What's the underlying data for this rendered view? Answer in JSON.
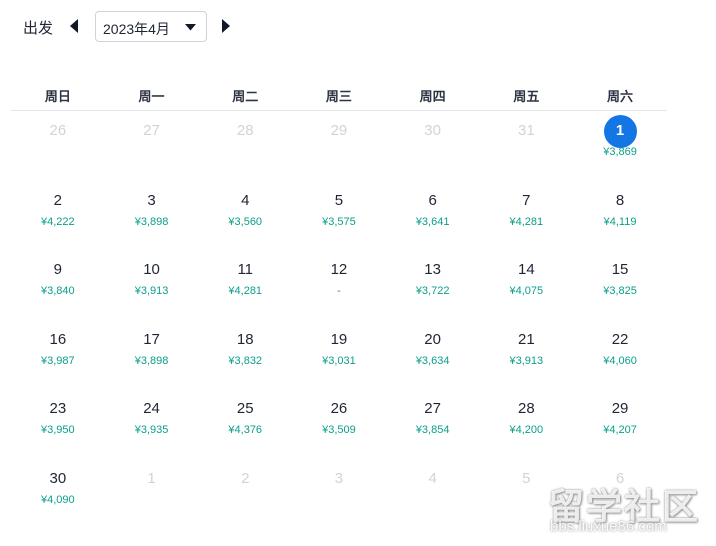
{
  "toolbar": {
    "depart_label": "出发",
    "month_value": "2023年4月",
    "prev_icon": "caret-left-icon",
    "next_icon": "caret-right-icon",
    "dropdown_icon": "caret-down-icon"
  },
  "weekdays": [
    "周日",
    "周一",
    "周二",
    "周三",
    "周四",
    "周五",
    "周六"
  ],
  "colors": {
    "price": "#0b9e8a",
    "selected": "#1476e4",
    "disabled_text": "#d0d3d9"
  },
  "calendar": {
    "weeks": [
      [
        {
          "day": "26",
          "price": "",
          "state": "disabled"
        },
        {
          "day": "27",
          "price": "",
          "state": "disabled"
        },
        {
          "day": "28",
          "price": "",
          "state": "disabled"
        },
        {
          "day": "29",
          "price": "",
          "state": "disabled"
        },
        {
          "day": "30",
          "price": "",
          "state": "disabled"
        },
        {
          "day": "31",
          "price": "",
          "state": "disabled"
        },
        {
          "day": "1",
          "price": "¥3,869",
          "state": "selected"
        }
      ],
      [
        {
          "day": "2",
          "price": "¥4,222",
          "state": "normal"
        },
        {
          "day": "3",
          "price": "¥3,898",
          "state": "normal"
        },
        {
          "day": "4",
          "price": "¥3,560",
          "state": "normal"
        },
        {
          "day": "5",
          "price": "¥3,575",
          "state": "normal"
        },
        {
          "day": "6",
          "price": "¥3,641",
          "state": "normal"
        },
        {
          "day": "7",
          "price": "¥4,281",
          "state": "normal"
        },
        {
          "day": "8",
          "price": "¥4,119",
          "state": "normal"
        }
      ],
      [
        {
          "day": "9",
          "price": "¥3,840",
          "state": "normal"
        },
        {
          "day": "10",
          "price": "¥3,913",
          "state": "normal"
        },
        {
          "day": "11",
          "price": "¥4,281",
          "state": "normal"
        },
        {
          "day": "12",
          "price": "-",
          "state": "normal"
        },
        {
          "day": "13",
          "price": "¥3,722",
          "state": "normal"
        },
        {
          "day": "14",
          "price": "¥4,075",
          "state": "normal"
        },
        {
          "day": "15",
          "price": "¥3,825",
          "state": "normal"
        }
      ],
      [
        {
          "day": "16",
          "price": "¥3,987",
          "state": "normal"
        },
        {
          "day": "17",
          "price": "¥3,898",
          "state": "normal"
        },
        {
          "day": "18",
          "price": "¥3,832",
          "state": "normal"
        },
        {
          "day": "19",
          "price": "¥3,031",
          "state": "normal"
        },
        {
          "day": "20",
          "price": "¥3,634",
          "state": "normal"
        },
        {
          "day": "21",
          "price": "¥3,913",
          "state": "normal"
        },
        {
          "day": "22",
          "price": "¥4,060",
          "state": "normal"
        }
      ],
      [
        {
          "day": "23",
          "price": "¥3,950",
          "state": "normal"
        },
        {
          "day": "24",
          "price": "¥3,935",
          "state": "normal"
        },
        {
          "day": "25",
          "price": "¥4,376",
          "state": "normal"
        },
        {
          "day": "26",
          "price": "¥3,509",
          "state": "normal"
        },
        {
          "day": "27",
          "price": "¥3,854",
          "state": "normal"
        },
        {
          "day": "28",
          "price": "¥4,200",
          "state": "normal"
        },
        {
          "day": "29",
          "price": "¥4,207",
          "state": "normal"
        }
      ],
      [
        {
          "day": "30",
          "price": "¥4,090",
          "state": "normal"
        },
        {
          "day": "1",
          "price": "",
          "state": "disabled"
        },
        {
          "day": "2",
          "price": "",
          "state": "disabled"
        },
        {
          "day": "3",
          "price": "",
          "state": "disabled"
        },
        {
          "day": "4",
          "price": "",
          "state": "disabled"
        },
        {
          "day": "5",
          "price": "",
          "state": "disabled"
        },
        {
          "day": "6",
          "price": "",
          "state": "disabled"
        }
      ]
    ]
  },
  "watermark": {
    "title": "留学社区",
    "url": "bbs.liuxue86.com"
  }
}
